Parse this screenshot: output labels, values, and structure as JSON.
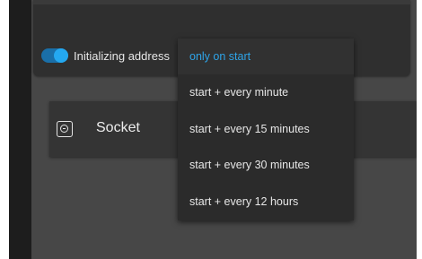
{
  "address_toggle": {
    "label": "Initializing address",
    "enabled": true
  },
  "device": {
    "name": "Socket",
    "icon": "socket-icon"
  },
  "interval_menu": {
    "selected_index": 0,
    "options": [
      "only on start",
      "start + every minute",
      "start + every 15 minutes",
      "start + every 30 minutes",
      "start + every 12 hours"
    ]
  },
  "colors": {
    "accent": "#2ea4e8",
    "toggle_track": "#1a6fa8",
    "background": "#474747",
    "menu_background": "#2b2b2b"
  }
}
